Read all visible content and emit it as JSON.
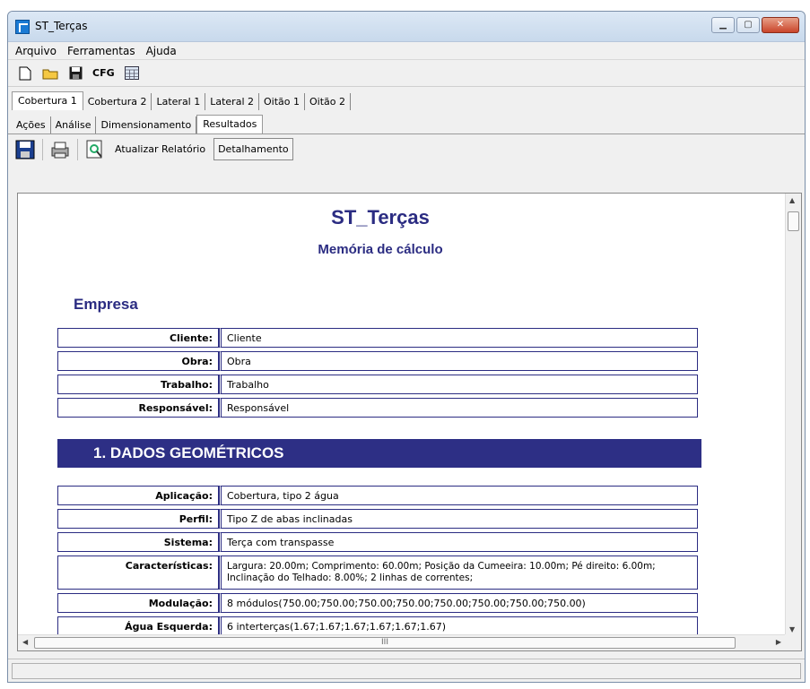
{
  "window": {
    "title": "ST_Terças"
  },
  "menu": [
    "Arquivo",
    "Ferramentas",
    "Ajuda"
  ],
  "toolbar": {
    "cfg_label": "CFG"
  },
  "tabs_main": [
    "Cobertura 1",
    "Cobertura 2",
    "Lateral 1",
    "Lateral 2",
    "Oitão 1",
    "Oitão 2"
  ],
  "tabs_sub": [
    "Ações",
    "Análise",
    "Dimensionamento",
    "Resultados"
  ],
  "report_toolbar": {
    "update_label": "Atualizar Relatório",
    "detail_label": "Detalhamento"
  },
  "report": {
    "title": "ST_Terças",
    "subtitle": "Memória de cálculo",
    "company_heading": "Empresa",
    "company_rows": [
      {
        "key": "Cliente:",
        "value": "Cliente"
      },
      {
        "key": "Obra:",
        "value": "Obra"
      },
      {
        "key": "Trabalho:",
        "value": "Trabalho"
      },
      {
        "key": "Responsável:",
        "value": "Responsável"
      }
    ],
    "section1_title": "1. DADOS GEOMÉTRICOS",
    "geo_rows": [
      {
        "key": "Aplicação:",
        "value": "Cobertura, tipo 2 água"
      },
      {
        "key": "Perfil:",
        "value": "Tipo Z de abas inclinadas"
      },
      {
        "key": "Sistema:",
        "value": "Terça com transpasse"
      },
      {
        "key": "Características:",
        "value": "Largura: 20.00m; Comprimento: 60.00m; Posição da Cumeeira: 10.00m; Pé direito: 6.00m; Inclinação do Telhado: 8.00%; 2 linhas de correntes;"
      },
      {
        "key": "Modulação:",
        "value": "8 módulos(750.00;750.00;750.00;750.00;750.00;750.00;750.00;750.00)"
      },
      {
        "key": "Água Esquerda:",
        "value": "6 interterças(1.67;1.67;1.67;1.67;1.67;1.67)"
      }
    ],
    "hscroll_grip": "III"
  }
}
